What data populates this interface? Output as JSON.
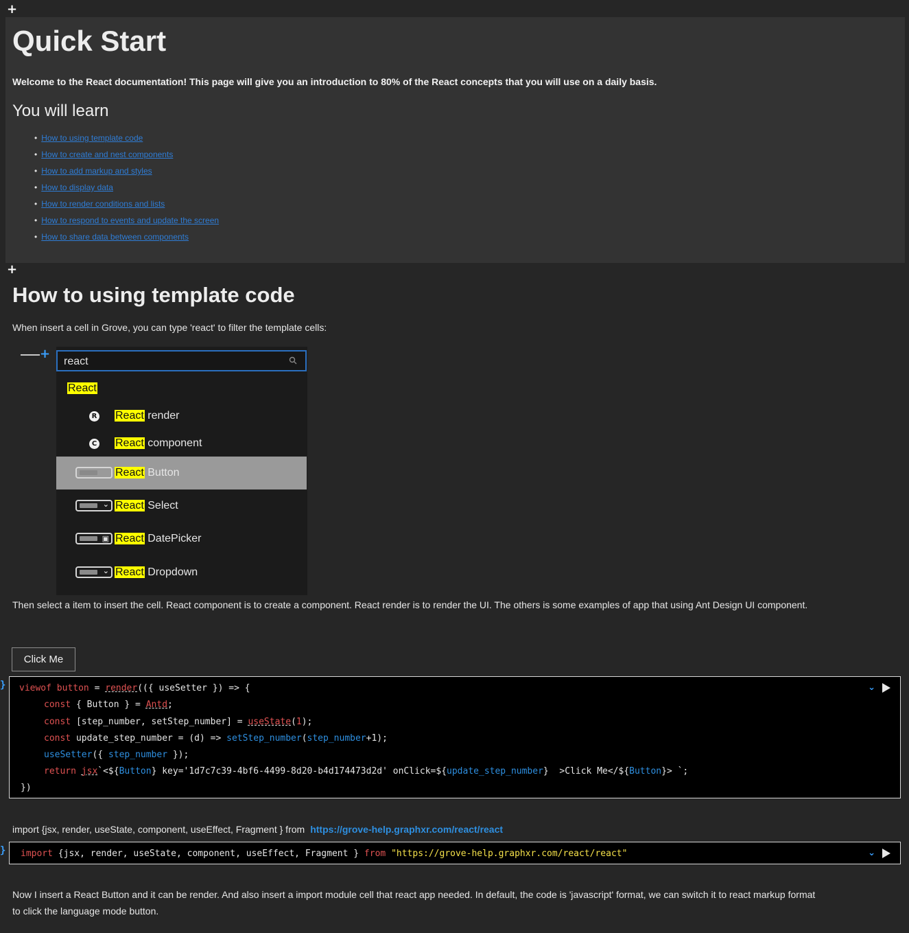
{
  "intro": {
    "title": "Quick Start",
    "lead": "Welcome to the React documentation! This page will give you an introduction to 80% of the React concepts that you will use on a daily basis.",
    "learn_heading": "You will learn",
    "toc": [
      "How to using template code",
      "How to create and nest components",
      "How to add markup and styles",
      "How to display data",
      "How to render conditions and lists",
      "How to respond to events and update the screen",
      "How to share data between components"
    ]
  },
  "section": {
    "title": "How to using template code",
    "intro_text": "When insert a cell in Grove, you can type 'react' to filter the template cells:",
    "popup": {
      "search_value": "react",
      "group_label": "React",
      "highlight": "React",
      "items": [
        {
          "icon": "R",
          "rest": "render"
        },
        {
          "icon": "C",
          "rest": "component"
        },
        {
          "icon": "button-icon",
          "rest": "Button"
        },
        {
          "icon": "select-icon",
          "rest": "Select"
        },
        {
          "icon": "datepicker-icon",
          "rest": "DatePicker"
        },
        {
          "icon": "dropdown-icon",
          "rest": "Dropdown"
        }
      ]
    },
    "after_text": "Then select a item to insert the cell. React component is to create a component. React render is to render the UI. The others is some examples of app that using Ant Design UI component.",
    "button_label": "Click Me",
    "import_label": "import {jsx, render, useState, component, useEffect, Fragment } from",
    "import_link": "https://grove-help.graphxr.com/react/react",
    "bottom_text_1": "Now I insert a React Button and it can be render. And also insert a import module cell that react app needed. In default, the code is 'javascript' format, we can switch it to react markup format",
    "bottom_text_2": "to click the language mode button."
  },
  "code": {
    "c1": "viewof",
    "c2": "button",
    "c3": "=",
    "c4": "render",
    "c5": "(({ useSetter }) => {",
    "l2a": "const",
    "l2b": "{ Button } =",
    "l2c": "Antd",
    "l2d": ";",
    "l3a": "const",
    "l3b": "[step_number, setStep_number] =",
    "l3c": "useState",
    "l3d": "(",
    "l3e": "1",
    "l3f": ");",
    "l4a": "const",
    "l4b": "update_step_number = (d) =>",
    "l4c": "setStep_number",
    "l4d": "(",
    "l4e": "step_number",
    "l4f": "+1);",
    "l5a": "useSetter",
    "l5b": "({",
    "l5c": "step_number",
    "l5d": "});",
    "l6a": "return",
    "l6b": "jsx",
    "l6c": "`<${",
    "l6d": "Button",
    "l6e": "} key='1d7c7c39-4bf6-4499-8d20-b4d174473d2d' onClick=${",
    "l6f": "update_step_number",
    "l6g": "}  >Click Me</${",
    "l6h": "Button",
    "l6i": "}> `;",
    "l7": "})",
    "imp_kw": "import",
    "imp_mid": "{jsx, render, useState, component, useEffect, Fragment }",
    "imp_from": "from",
    "imp_url": "\"https://grove-help.graphxr.com/react/react\""
  },
  "colors": {
    "link": "#2f7dd6",
    "keyword": "#e05252",
    "highlight": "#ffff00"
  }
}
